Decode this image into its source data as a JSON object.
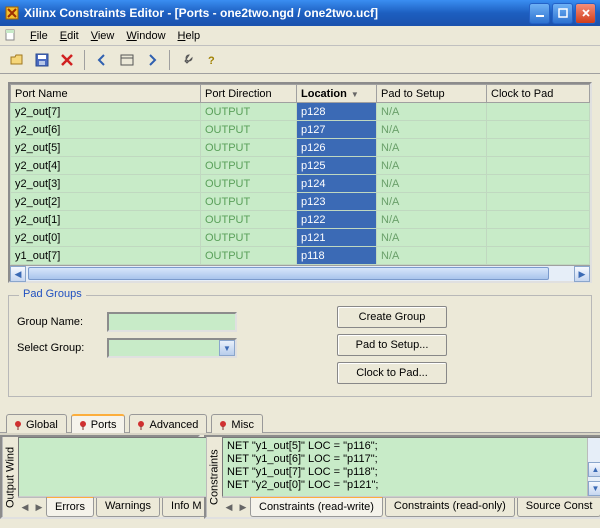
{
  "window": {
    "title": "Xilinx Constraints Editor - [Ports - one2two.ngd / one2two.ucf]"
  },
  "menu": {
    "file": "File",
    "edit": "Edit",
    "view": "View",
    "window": "Window",
    "help": "Help"
  },
  "grid": {
    "headers": {
      "portname": "Port Name",
      "direction": "Port Direction",
      "location": "Location",
      "pad2setup": "Pad to Setup",
      "clock2pad": "Clock to Pad"
    },
    "rows": [
      {
        "name": "y2_out[7]",
        "dir": "OUTPUT",
        "loc": "p128",
        "p2s": "N/A",
        "c2p": ""
      },
      {
        "name": "y2_out[6]",
        "dir": "OUTPUT",
        "loc": "p127",
        "p2s": "N/A",
        "c2p": ""
      },
      {
        "name": "y2_out[5]",
        "dir": "OUTPUT",
        "loc": "p126",
        "p2s": "N/A",
        "c2p": ""
      },
      {
        "name": "y2_out[4]",
        "dir": "OUTPUT",
        "loc": "p125",
        "p2s": "N/A",
        "c2p": ""
      },
      {
        "name": "y2_out[3]",
        "dir": "OUTPUT",
        "loc": "p124",
        "p2s": "N/A",
        "c2p": ""
      },
      {
        "name": "y2_out[2]",
        "dir": "OUTPUT",
        "loc": "p123",
        "p2s": "N/A",
        "c2p": ""
      },
      {
        "name": "y2_out[1]",
        "dir": "OUTPUT",
        "loc": "p122",
        "p2s": "N/A",
        "c2p": ""
      },
      {
        "name": "y2_out[0]",
        "dir": "OUTPUT",
        "loc": "p121",
        "p2s": "N/A",
        "c2p": ""
      },
      {
        "name": "y1_out[7]",
        "dir": "OUTPUT",
        "loc": "p118",
        "p2s": "N/A",
        "c2p": ""
      }
    ]
  },
  "padgroups": {
    "legend": "Pad Groups",
    "groupname_label": "Group Name:",
    "selectgroup_label": "Select Group:",
    "create": "Create Group",
    "pad2setup": "Pad to Setup...",
    "clock2pad": "Clock to Pad..."
  },
  "maintabs": {
    "global": "Global",
    "ports": "Ports",
    "advanced": "Advanced",
    "misc": "Misc"
  },
  "bottomleft": {
    "title": "Output Wind",
    "tabs": {
      "errors": "Errors",
      "warnings": "Warnings",
      "info": "Info M"
    }
  },
  "bottomright": {
    "title": "Constraints",
    "lines": "NET \"y1_out[5]\" LOC = \"p116\";\nNET \"y1_out[6]\" LOC = \"p117\";\nNET \"y1_out[7]\" LOC = \"p118\";\nNET \"y2_out[0]\" LOC = \"p121\";",
    "tabs": {
      "rw": "Constraints (read-write)",
      "ro": "Constraints (read-only)",
      "src": "Source Const"
    }
  }
}
